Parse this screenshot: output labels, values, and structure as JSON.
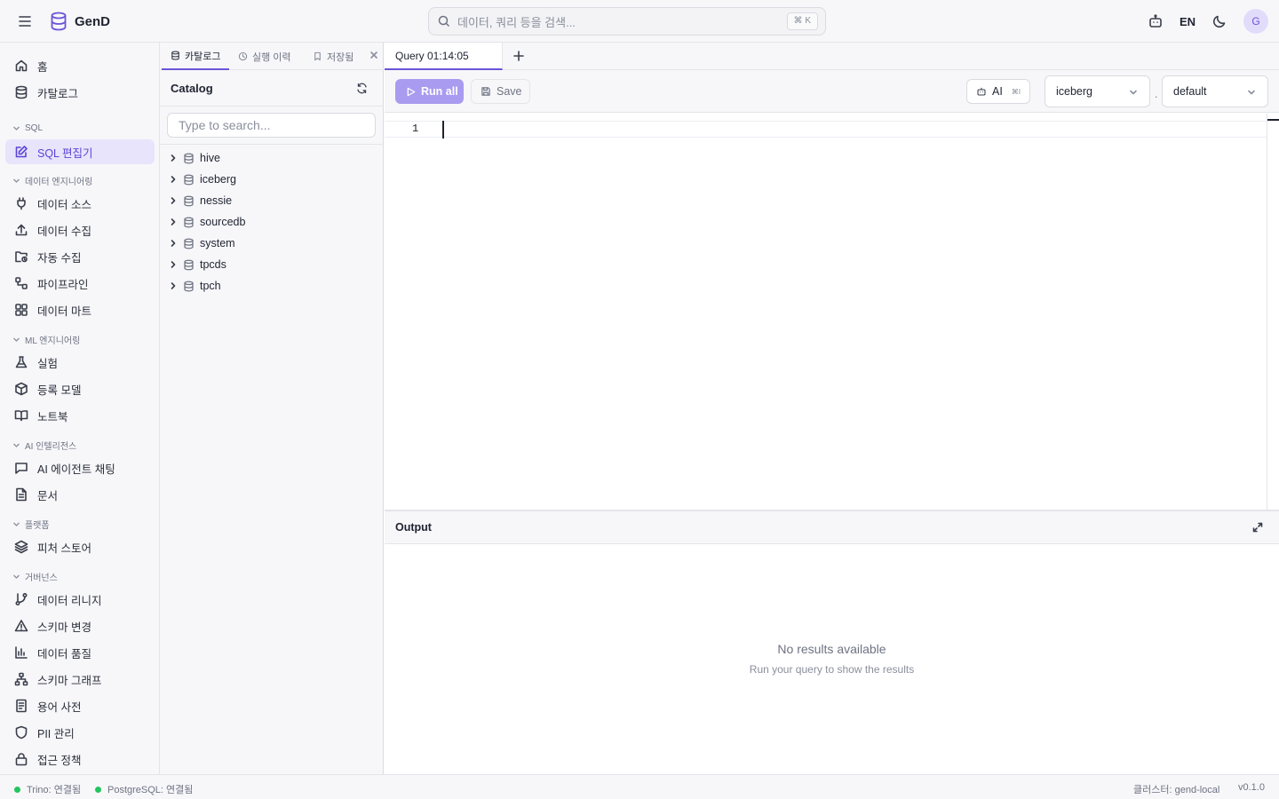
{
  "app": {
    "name": "GenD"
  },
  "header": {
    "search_placeholder": "데이터, 쿼리 등을 검색...",
    "search_shortcut": "⌘ K",
    "lang": "EN",
    "avatar": "G"
  },
  "sidebar": {
    "home": "홈",
    "catalog": "카탈로그",
    "sections": {
      "sql": "SQL",
      "data_eng": "데이터 엔지니어링",
      "ml_eng": "ML 엔지니어링",
      "ai": "AI 인텔리전스",
      "platform": "플랫폼",
      "governance": "거버넌스"
    },
    "sql_editor": "SQL 편집기",
    "data_source": "데이터 소스",
    "data_ingest": "데이터 수집",
    "auto_ingest": "자동 수집",
    "pipeline": "파이프라인",
    "data_mart": "데이터 마트",
    "experiment": "실험",
    "registered_model": "등록 모델",
    "notebook": "노트북",
    "ai_agent_chat": "AI 에이전트 채팅",
    "documents": "문서",
    "feature_store": "피처 스토어",
    "data_lineage": "데이터 리니지",
    "schema_change": "스키마 변경",
    "data_quality": "데이터 품질",
    "schema_graph": "스키마 그래프",
    "glossary": "용어 사전",
    "pii": "PII 관리",
    "access_policy": "접근 정책"
  },
  "catalog_panel": {
    "tabs": [
      "카탈로그",
      "실행 이력",
      "저장됨"
    ],
    "title": "Catalog",
    "search_placeholder": "Type to search...",
    "items": [
      "hive",
      "iceberg",
      "nessie",
      "sourcedb",
      "system",
      "tpcds",
      "tpch"
    ]
  },
  "editor": {
    "tab_title": "Query 01:14:05",
    "run_all": "Run all",
    "save": "Save",
    "ai": "AI",
    "ai_shortcut": "⌘I",
    "catalog_value": "iceberg",
    "schema_separator": ".",
    "schema_value": "default",
    "line_number": "1"
  },
  "output": {
    "title": "Output",
    "empty_title": "No results available",
    "empty_subtitle": "Run your query to show the results"
  },
  "status": {
    "trino": "Trino: 연결됨",
    "postgres": "PostgreSQL: 연결됨",
    "cluster": "클러스터: gend-local",
    "version": "v0.1.0"
  },
  "colors": {
    "accent": "#6b54d8",
    "run_button": "#a99bf0",
    "connected": "#22c55e"
  }
}
